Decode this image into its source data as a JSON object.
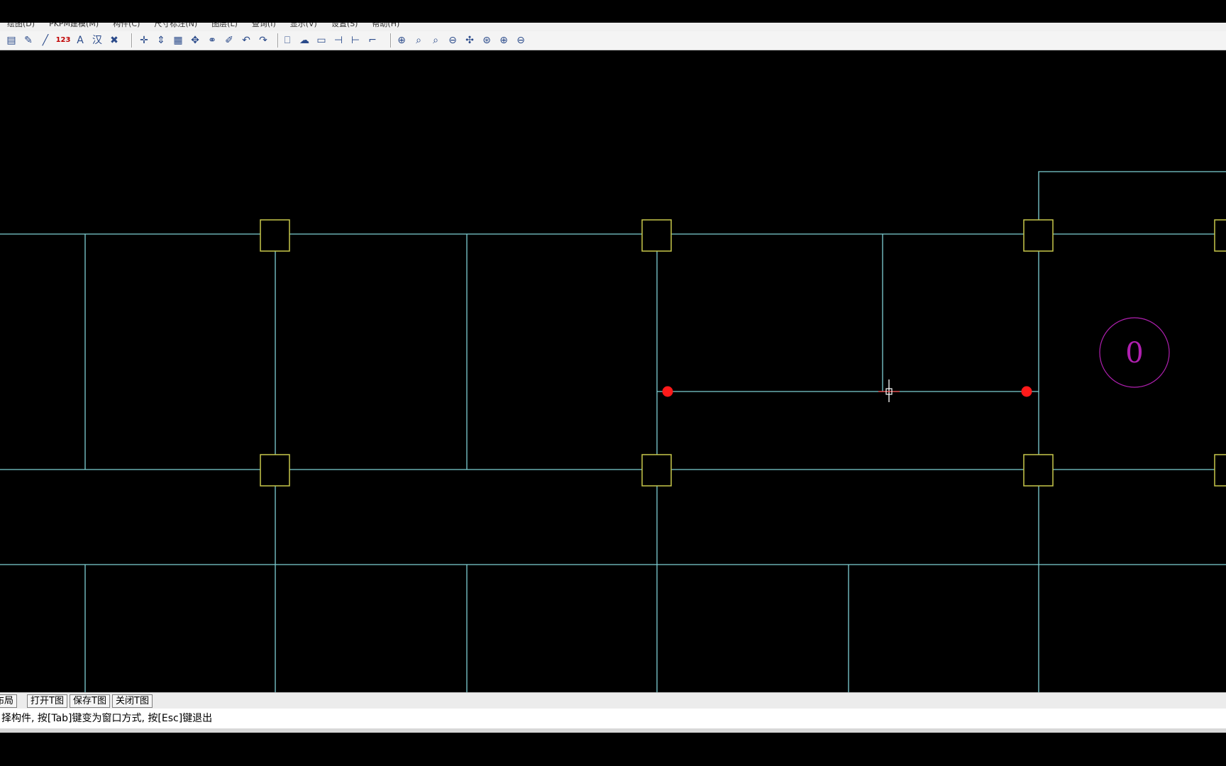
{
  "menu": {
    "items": [
      "绘图(D)",
      "PKPM建模(M)",
      "构件(C)",
      "尺寸标注(N)",
      "图层(L)",
      "查询(I)",
      "显示(V)",
      "设置(S)",
      "帮助(H)"
    ]
  },
  "toolbar": {
    "icons": [
      {
        "name": "layer-icon",
        "glyph": "▤"
      },
      {
        "name": "brush-icon",
        "glyph": "✎"
      },
      {
        "name": "line-icon",
        "glyph": "╱"
      },
      {
        "name": "number-text-icon",
        "glyph": "123"
      },
      {
        "name": "text-style-icon",
        "glyph": "A"
      },
      {
        "name": "chinese-text-icon",
        "glyph": "汉"
      },
      {
        "name": "erase-icon",
        "glyph": "✖"
      },
      {
        "name": "snap-icon",
        "glyph": "✛"
      },
      {
        "name": "move-vertical-icon",
        "glyph": "⇕"
      },
      {
        "name": "grid-icon",
        "glyph": "▦"
      },
      {
        "name": "move-icon",
        "glyph": "✥"
      },
      {
        "name": "copy-icon",
        "glyph": "⚭"
      },
      {
        "name": "edit-icon",
        "glyph": "✐"
      },
      {
        "name": "undo-icon",
        "glyph": "↶"
      },
      {
        "name": "redo-icon",
        "glyph": "↷"
      },
      {
        "name": "page-icon",
        "glyph": "⎕"
      },
      {
        "name": "cloud-icon",
        "glyph": "☁"
      },
      {
        "name": "rectangle-icon",
        "glyph": "▭"
      },
      {
        "name": "trim-icon",
        "glyph": "⊣"
      },
      {
        "name": "extend-icon",
        "glyph": "⊢"
      },
      {
        "name": "fillet-icon",
        "glyph": "⌐"
      },
      {
        "name": "zoom-window-icon",
        "glyph": "⊕"
      },
      {
        "name": "zoom-realtime-icon",
        "glyph": "⌕"
      },
      {
        "name": "zoom-previous-icon",
        "glyph": "⌕"
      },
      {
        "name": "zoom-extents-icon",
        "glyph": "⊖"
      },
      {
        "name": "pan-icon",
        "glyph": "✣"
      },
      {
        "name": "zoom-all-icon",
        "glyph": "⊛"
      },
      {
        "name": "zoom-in-icon",
        "glyph": "⊕"
      },
      {
        "name": "zoom-out-icon",
        "glyph": "⊖"
      }
    ]
  },
  "drawing": {
    "axis_label": "0"
  },
  "colors": {
    "canvas": "#000000",
    "beam": "#7ecfd4",
    "column": "#c8c84a",
    "grip": "#ff1a1a",
    "axis": "#b020b0",
    "crosshair": "#ffffff"
  },
  "tabs": [
    "布局",
    "打开T图",
    "保存T图",
    "关闭T图"
  ],
  "command": {
    "prompt": "择构件, 按[Tab]键变为窗口方式, 按[Esc]键退出"
  }
}
